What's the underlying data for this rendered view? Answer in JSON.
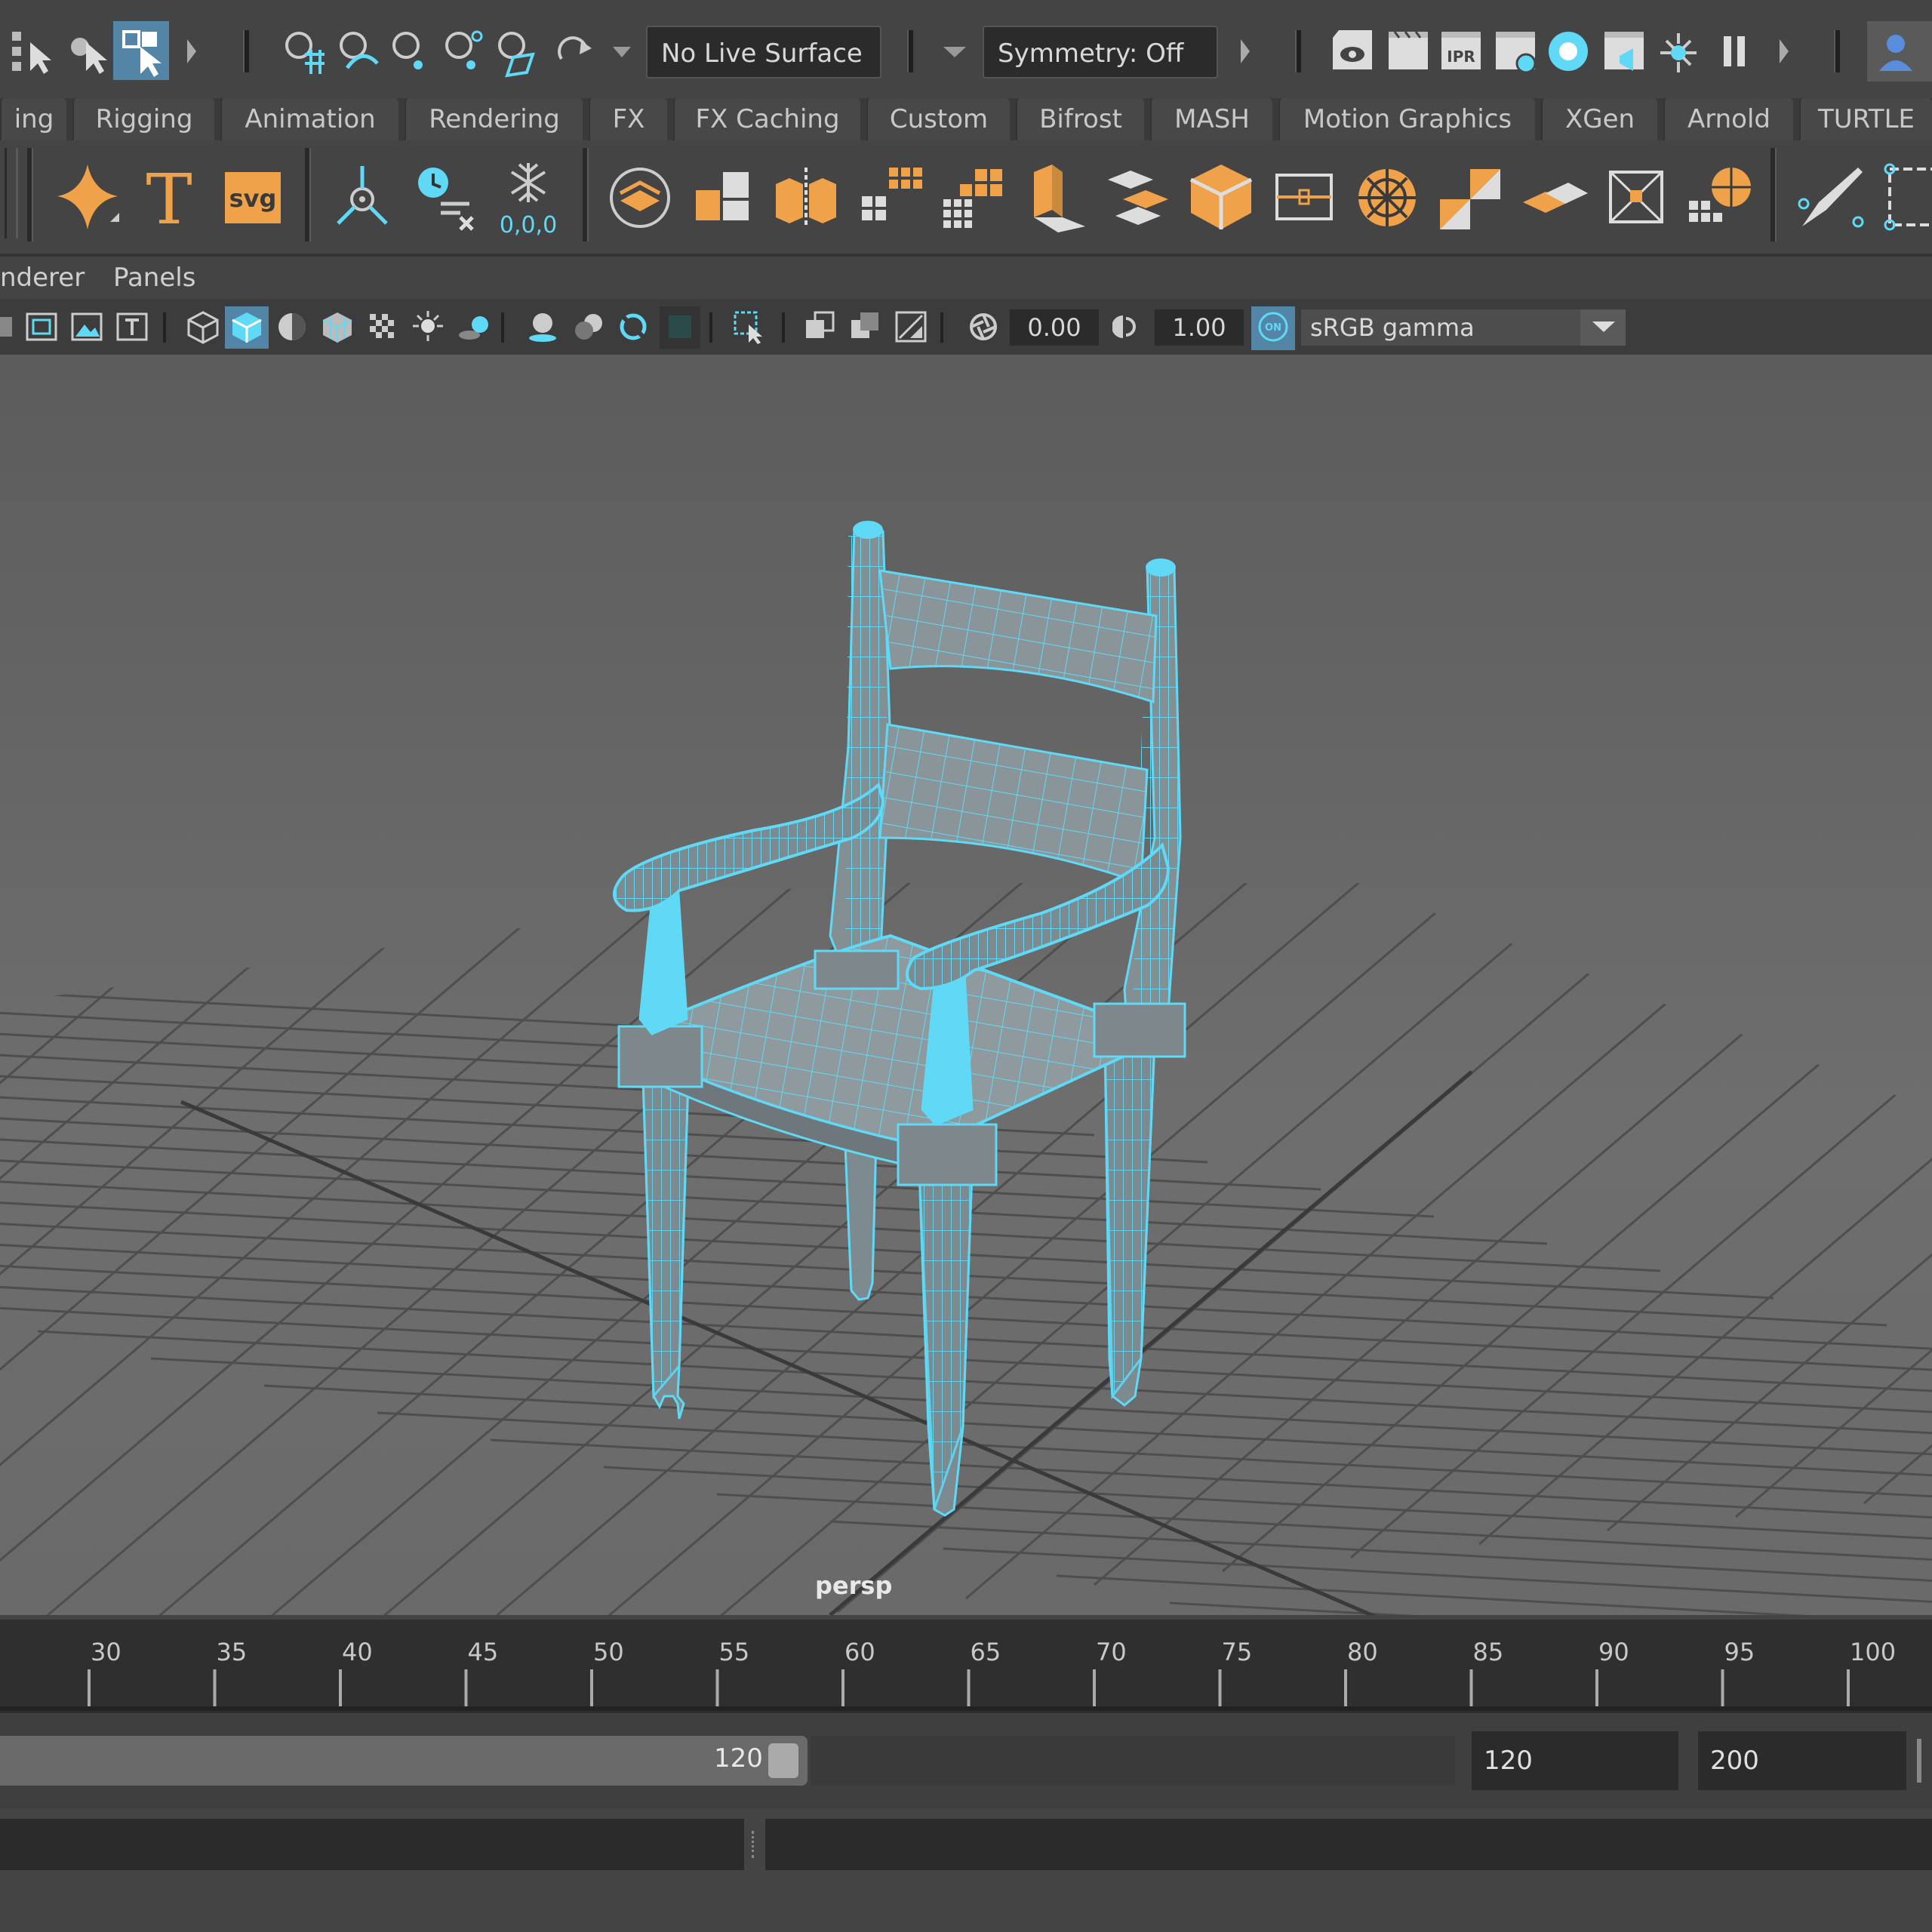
{
  "status_line": {
    "live_surface": "No Live Surface",
    "symmetry": "Symmetry: Off",
    "ipr_label": "IPR"
  },
  "shelf_tabs": [
    "ing",
    "Rigging",
    "Animation",
    "Rendering",
    "FX",
    "FX Caching",
    "Custom",
    "Bifrost",
    "MASH",
    "Motion Graphics",
    "XGen",
    "Arnold",
    "TURTLE"
  ],
  "shelf": {
    "text_icon": "T",
    "svg_icon": "svg",
    "freeze_label": "0,0,0"
  },
  "panel_menu": [
    "nderer",
    "Panels"
  ],
  "panel_toolbar": {
    "exposure": "0.00",
    "gamma": "1.00",
    "on_label": "ON",
    "colorspace": "sRGB gamma"
  },
  "viewport": {
    "camera_label": "persp",
    "accent_color": "#5fd9f5"
  },
  "time_slider": {
    "ticks": [
      "30",
      "35",
      "40",
      "45",
      "50",
      "55",
      "60",
      "65",
      "70",
      "75",
      "80",
      "85",
      "90",
      "95",
      "100"
    ]
  },
  "range_slider": {
    "range_end_label": "120",
    "end_time": "120",
    "end_anim": "200"
  }
}
